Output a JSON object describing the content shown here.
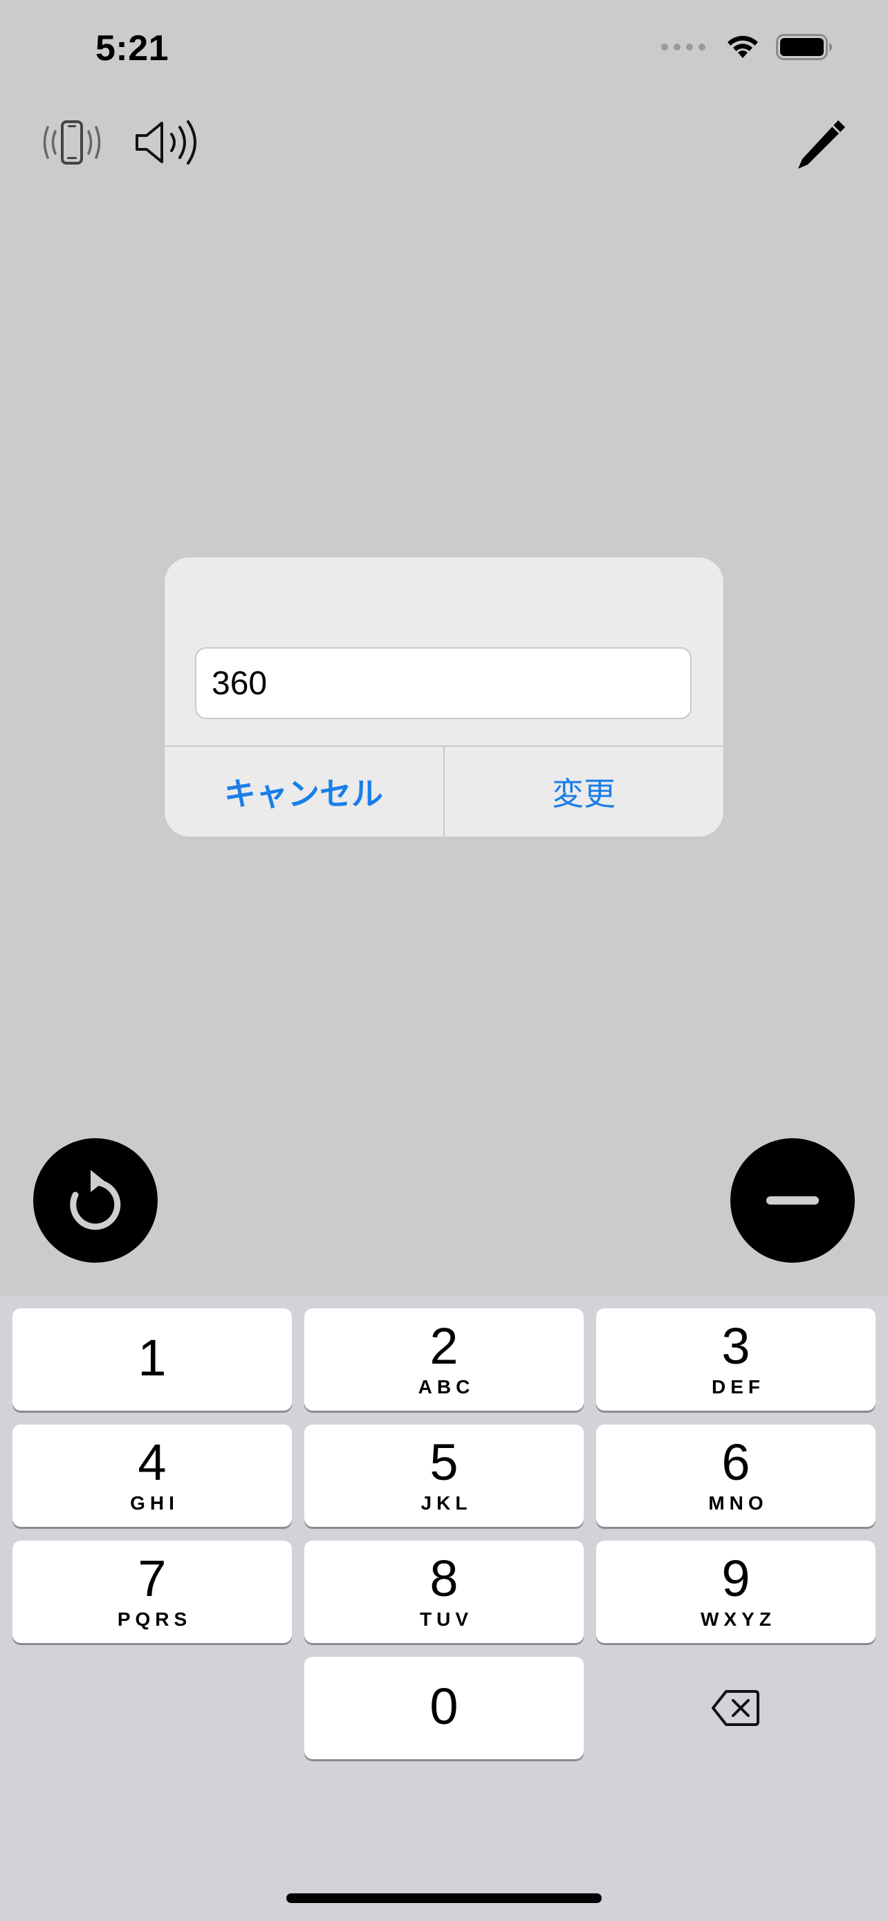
{
  "status_bar": {
    "time": "5:21"
  },
  "top_bar": {
    "vibrate_icon": "phone-vibrate-icon",
    "sound_icon": "speaker-wave-icon",
    "edit_icon": "pencil-icon"
  },
  "dialog": {
    "input_value": "360",
    "cancel_label": "キャンセル",
    "change_label": "変更",
    "accent_color": "#1a7ee8"
  },
  "controls": {
    "reset_icon": "rotate-clockwise-icon",
    "minus_icon": "minus-icon"
  },
  "keypad": {
    "keys": [
      {
        "digit": "1",
        "letters": ""
      },
      {
        "digit": "2",
        "letters": "ABC"
      },
      {
        "digit": "3",
        "letters": "DEF"
      },
      {
        "digit": "4",
        "letters": "GHI"
      },
      {
        "digit": "5",
        "letters": "JKL"
      },
      {
        "digit": "6",
        "letters": "MNO"
      },
      {
        "digit": "7",
        "letters": "PQRS"
      },
      {
        "digit": "8",
        "letters": "TUV"
      },
      {
        "digit": "9",
        "letters": "WXYZ"
      },
      {
        "digit": "0",
        "letters": ""
      }
    ],
    "backspace_icon": "backspace-icon"
  }
}
